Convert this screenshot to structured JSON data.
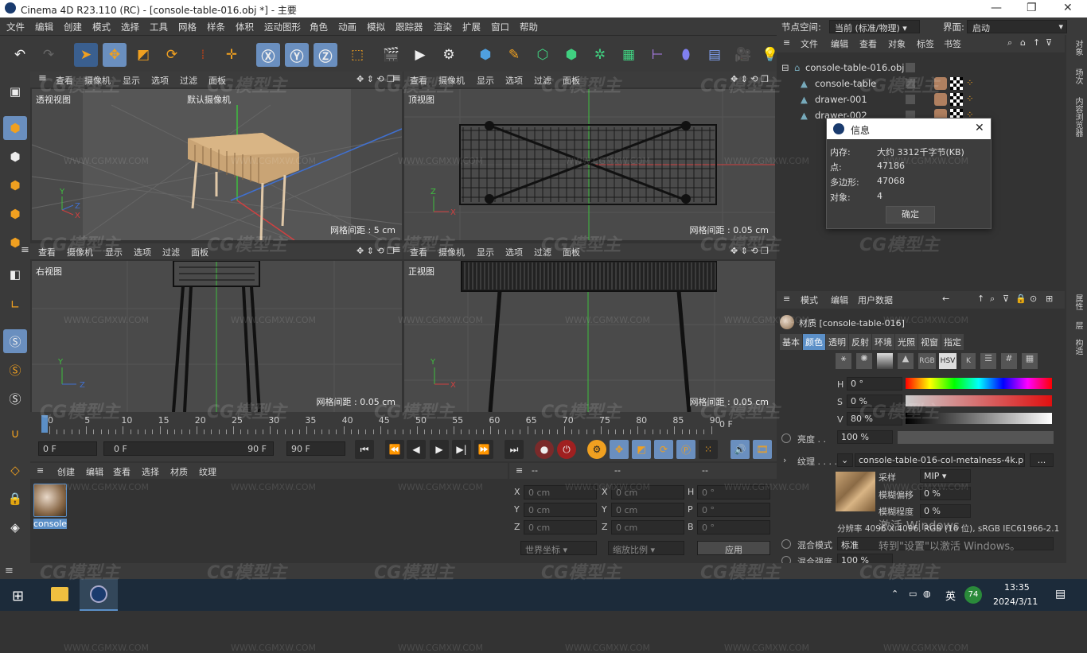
{
  "window": {
    "title": "Cinema 4D R23.110 (RC) - [console-table-016.obj *] - 主要"
  },
  "menu": [
    "文件",
    "编辑",
    "创建",
    "模式",
    "选择",
    "工具",
    "网格",
    "样条",
    "体积",
    "运动图形",
    "角色",
    "动画",
    "模拟",
    "跟踪器",
    "渲染",
    "扩展",
    "窗口",
    "帮助"
  ],
  "node_space": {
    "label": "节点空间:",
    "value": "当前 (标准/物理)"
  },
  "layout": {
    "label": "界面:",
    "value": "启动"
  },
  "viewport_menu": [
    "查看",
    "摄像机",
    "显示",
    "选项",
    "过滤",
    "面板"
  ],
  "viewports": [
    {
      "name": "透视视图",
      "camera": "默认摄像机",
      "grid": "网格间距 : 5 cm"
    },
    {
      "name": "顶视图",
      "grid": "网格间距 : 0.05 cm"
    },
    {
      "name": "右视图",
      "grid": "网格间距 : 0.05 cm"
    },
    {
      "name": "正视图",
      "grid": "网格间距 : 0.05 cm"
    }
  ],
  "timeline": {
    "ticks": [
      "0",
      "5",
      "10",
      "15",
      "20",
      "25",
      "30",
      "35",
      "40",
      "45",
      "50",
      "55",
      "60",
      "65",
      "70",
      "75",
      "80",
      "85",
      "90"
    ],
    "end_label": "0 F"
  },
  "transport": {
    "current": "0 F",
    "range_start": "0 F",
    "range_end": "90 F",
    "max": "90 F"
  },
  "material_manager": {
    "menu": [
      "创建",
      "编辑",
      "查看",
      "选择",
      "材质",
      "纹理"
    ],
    "material_name": "console"
  },
  "coords": {
    "header": [
      "--",
      "--",
      "--"
    ],
    "rows": [
      {
        "a": "X",
        "av": "0 cm",
        "b": "X",
        "bv": "0 cm",
        "c": "H",
        "cv": "0 °"
      },
      {
        "a": "Y",
        "av": "0 cm",
        "b": "Y",
        "bv": "0 cm",
        "c": "P",
        "cv": "0 °"
      },
      {
        "a": "Z",
        "av": "0 cm",
        "b": "Z",
        "bv": "0 cm",
        "c": "B",
        "cv": "0 °"
      }
    ],
    "mode": "世界坐标",
    "scale": "缩放比例",
    "apply": "应用"
  },
  "object_manager": {
    "menu": [
      "文件",
      "编辑",
      "查看",
      "对象",
      "标签",
      "书签"
    ],
    "objects": [
      "console-table-016.obj",
      "console-table",
      "drawer-001",
      "drawer-002"
    ]
  },
  "side_tabs": [
    "对象",
    "场次",
    "内容浏览器",
    "属性",
    "层",
    "构造"
  ],
  "info_dialog": {
    "title": "信息",
    "rows": [
      {
        "k": "内存:",
        "v": "大约 3312千字节(KB)"
      },
      {
        "k": "点:",
        "v": "47186"
      },
      {
        "k": "多边形:",
        "v": "47068"
      },
      {
        "k": "对象:",
        "v": "4"
      }
    ],
    "ok": "确定"
  },
  "attributes": {
    "menu": [
      "模式",
      "编辑",
      "用户数据"
    ],
    "title": "材质 [console-table-016]",
    "tabs": [
      "基本",
      "颜色",
      "透明",
      "反射",
      "环境",
      "光照",
      "视窗",
      "指定"
    ],
    "active_tab": "颜色",
    "color_modes": [
      "RGB",
      "HSV",
      "K"
    ],
    "h": {
      "label": "H",
      "value": "0 °"
    },
    "s": {
      "label": "S",
      "value": "0 %"
    },
    "v": {
      "label": "V",
      "value": "80 %"
    },
    "brightness": {
      "label": "亮度 . .",
      "value": "100 %"
    },
    "texture": {
      "label": "纹理 . . . . . .",
      "value": "console-table-016-col-metalness-4k.pn",
      "more": "..."
    },
    "sampling": {
      "label": "采样",
      "value": "MIP"
    },
    "blur_offset": {
      "label": "模糊偏移",
      "value": "0 %"
    },
    "blur_level": {
      "label": "模糊程度",
      "value": "0 %"
    },
    "resolution": "分辨率 4096 X 4096, RGB (16 位), sRGB IEC61966-2.1",
    "mix_mode": {
      "label": "混合模式",
      "value": "标准"
    },
    "mix_strength": {
      "label": "混合强度",
      "value": "100 %"
    }
  },
  "activation": {
    "line1": "激活 Windows",
    "line2": "转到\"设置\"以激活 Windows。"
  },
  "taskbar": {
    "time": "13:35",
    "date": "2024/3/11",
    "ime": "英",
    "badge": "74"
  },
  "watermark": {
    "logo": "CG模型主",
    "url": "WWW.CGMXW.COM"
  },
  "colors": {
    "accent": "#5b8fc7",
    "active_tool": "#6a8fbf",
    "green_axis": "#3fbf3f",
    "red_axis": "#d04040",
    "blue_axis": "#4070d0"
  }
}
